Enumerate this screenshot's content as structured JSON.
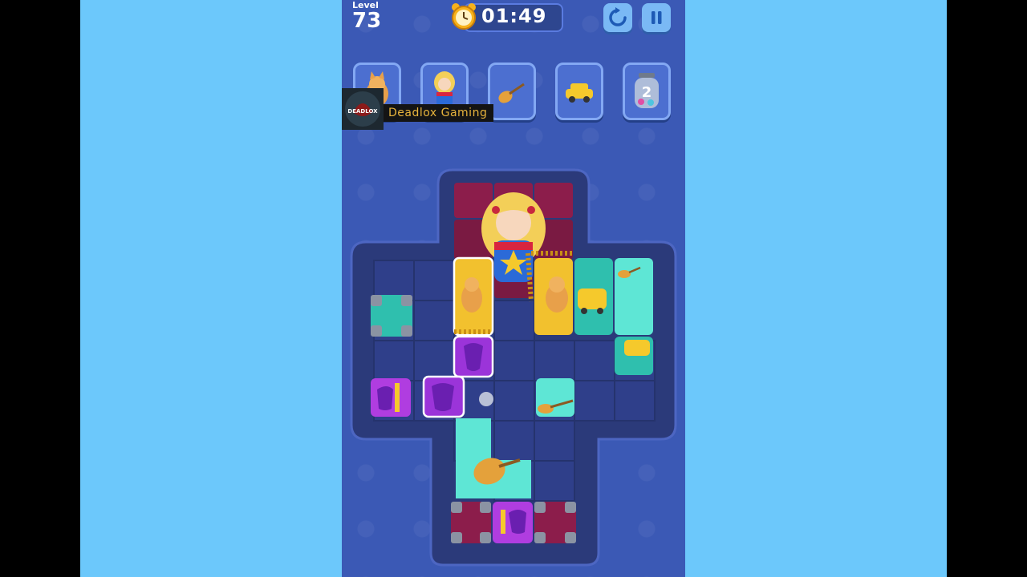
{
  "level": {
    "label": "Level",
    "number": "73"
  },
  "timer": {
    "value": "01:49"
  },
  "buttons": {
    "restart": "restart-icon",
    "pause": "pause-icon"
  },
  "goals": [
    {
      "item": "cat",
      "label": ""
    },
    {
      "item": "superhero-girl",
      "label": ""
    },
    {
      "item": "guitar",
      "label": ""
    },
    {
      "item": "taxi",
      "label": ""
    },
    {
      "item": "candy-jar",
      "label": "2"
    }
  ],
  "watermark": {
    "text": "Deadlox  Gaming",
    "logo_text": "DEADLOX"
  },
  "colors": {
    "background_side": "#6cc8fb",
    "game_bg": "#3b59b5",
    "board_frame": "#2b3a7a",
    "cell": "#2f3f8a",
    "yellow_block": "#f2c12e",
    "teal_block": "#3fd9c7",
    "purple_block": "#9b34d9",
    "maroon_block": "#8c1d4b"
  }
}
